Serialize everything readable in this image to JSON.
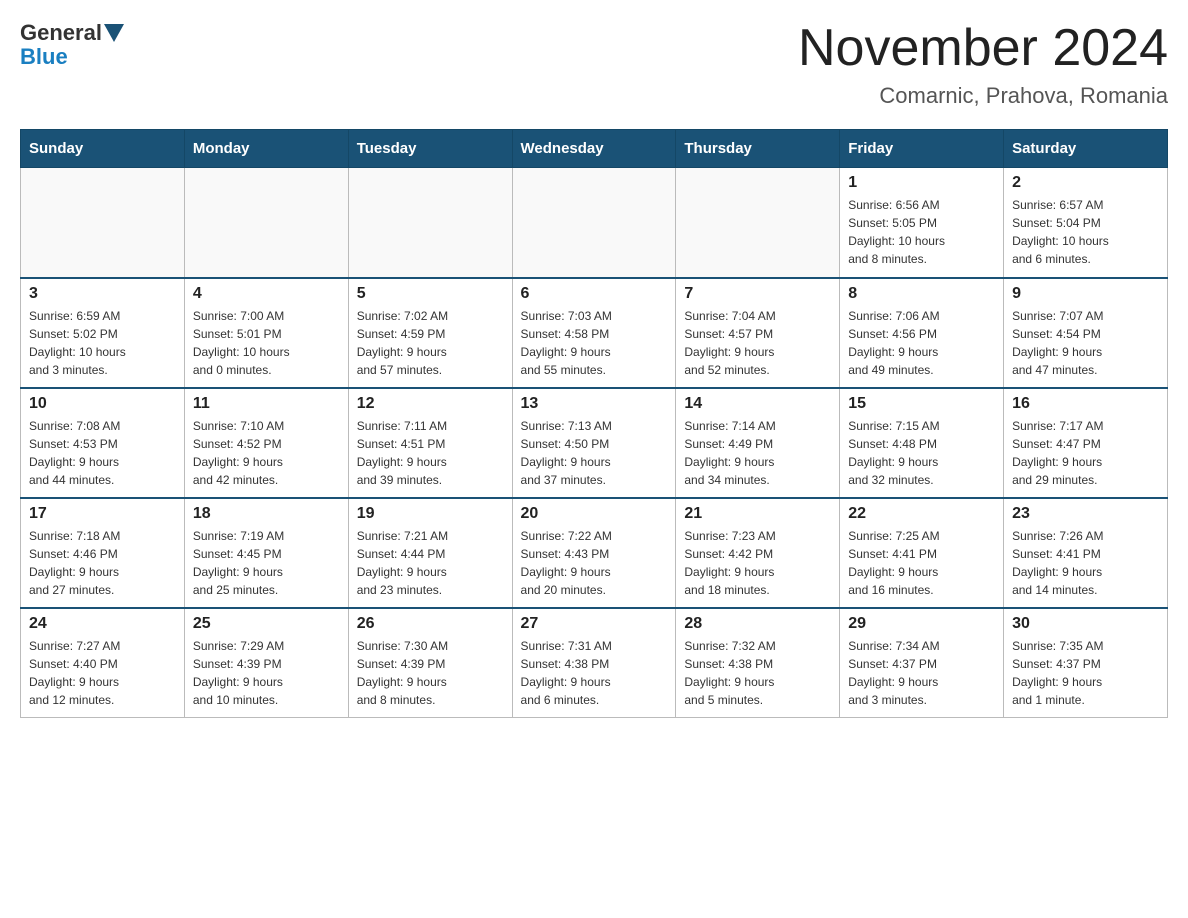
{
  "logo": {
    "general": "General",
    "blue": "Blue"
  },
  "header": {
    "title": "November 2024",
    "subtitle": "Comarnic, Prahova, Romania"
  },
  "weekdays": [
    "Sunday",
    "Monday",
    "Tuesday",
    "Wednesday",
    "Thursday",
    "Friday",
    "Saturday"
  ],
  "weeks": [
    [
      {
        "day": "",
        "info": ""
      },
      {
        "day": "",
        "info": ""
      },
      {
        "day": "",
        "info": ""
      },
      {
        "day": "",
        "info": ""
      },
      {
        "day": "",
        "info": ""
      },
      {
        "day": "1",
        "info": "Sunrise: 6:56 AM\nSunset: 5:05 PM\nDaylight: 10 hours\nand 8 minutes."
      },
      {
        "day": "2",
        "info": "Sunrise: 6:57 AM\nSunset: 5:04 PM\nDaylight: 10 hours\nand 6 minutes."
      }
    ],
    [
      {
        "day": "3",
        "info": "Sunrise: 6:59 AM\nSunset: 5:02 PM\nDaylight: 10 hours\nand 3 minutes."
      },
      {
        "day": "4",
        "info": "Sunrise: 7:00 AM\nSunset: 5:01 PM\nDaylight: 10 hours\nand 0 minutes."
      },
      {
        "day": "5",
        "info": "Sunrise: 7:02 AM\nSunset: 4:59 PM\nDaylight: 9 hours\nand 57 minutes."
      },
      {
        "day": "6",
        "info": "Sunrise: 7:03 AM\nSunset: 4:58 PM\nDaylight: 9 hours\nand 55 minutes."
      },
      {
        "day": "7",
        "info": "Sunrise: 7:04 AM\nSunset: 4:57 PM\nDaylight: 9 hours\nand 52 minutes."
      },
      {
        "day": "8",
        "info": "Sunrise: 7:06 AM\nSunset: 4:56 PM\nDaylight: 9 hours\nand 49 minutes."
      },
      {
        "day": "9",
        "info": "Sunrise: 7:07 AM\nSunset: 4:54 PM\nDaylight: 9 hours\nand 47 minutes."
      }
    ],
    [
      {
        "day": "10",
        "info": "Sunrise: 7:08 AM\nSunset: 4:53 PM\nDaylight: 9 hours\nand 44 minutes."
      },
      {
        "day": "11",
        "info": "Sunrise: 7:10 AM\nSunset: 4:52 PM\nDaylight: 9 hours\nand 42 minutes."
      },
      {
        "day": "12",
        "info": "Sunrise: 7:11 AM\nSunset: 4:51 PM\nDaylight: 9 hours\nand 39 minutes."
      },
      {
        "day": "13",
        "info": "Sunrise: 7:13 AM\nSunset: 4:50 PM\nDaylight: 9 hours\nand 37 minutes."
      },
      {
        "day": "14",
        "info": "Sunrise: 7:14 AM\nSunset: 4:49 PM\nDaylight: 9 hours\nand 34 minutes."
      },
      {
        "day": "15",
        "info": "Sunrise: 7:15 AM\nSunset: 4:48 PM\nDaylight: 9 hours\nand 32 minutes."
      },
      {
        "day": "16",
        "info": "Sunrise: 7:17 AM\nSunset: 4:47 PM\nDaylight: 9 hours\nand 29 minutes."
      }
    ],
    [
      {
        "day": "17",
        "info": "Sunrise: 7:18 AM\nSunset: 4:46 PM\nDaylight: 9 hours\nand 27 minutes."
      },
      {
        "day": "18",
        "info": "Sunrise: 7:19 AM\nSunset: 4:45 PM\nDaylight: 9 hours\nand 25 minutes."
      },
      {
        "day": "19",
        "info": "Sunrise: 7:21 AM\nSunset: 4:44 PM\nDaylight: 9 hours\nand 23 minutes."
      },
      {
        "day": "20",
        "info": "Sunrise: 7:22 AM\nSunset: 4:43 PM\nDaylight: 9 hours\nand 20 minutes."
      },
      {
        "day": "21",
        "info": "Sunrise: 7:23 AM\nSunset: 4:42 PM\nDaylight: 9 hours\nand 18 minutes."
      },
      {
        "day": "22",
        "info": "Sunrise: 7:25 AM\nSunset: 4:41 PM\nDaylight: 9 hours\nand 16 minutes."
      },
      {
        "day": "23",
        "info": "Sunrise: 7:26 AM\nSunset: 4:41 PM\nDaylight: 9 hours\nand 14 minutes."
      }
    ],
    [
      {
        "day": "24",
        "info": "Sunrise: 7:27 AM\nSunset: 4:40 PM\nDaylight: 9 hours\nand 12 minutes."
      },
      {
        "day": "25",
        "info": "Sunrise: 7:29 AM\nSunset: 4:39 PM\nDaylight: 9 hours\nand 10 minutes."
      },
      {
        "day": "26",
        "info": "Sunrise: 7:30 AM\nSunset: 4:39 PM\nDaylight: 9 hours\nand 8 minutes."
      },
      {
        "day": "27",
        "info": "Sunrise: 7:31 AM\nSunset: 4:38 PM\nDaylight: 9 hours\nand 6 minutes."
      },
      {
        "day": "28",
        "info": "Sunrise: 7:32 AM\nSunset: 4:38 PM\nDaylight: 9 hours\nand 5 minutes."
      },
      {
        "day": "29",
        "info": "Sunrise: 7:34 AM\nSunset: 4:37 PM\nDaylight: 9 hours\nand 3 minutes."
      },
      {
        "day": "30",
        "info": "Sunrise: 7:35 AM\nSunset: 4:37 PM\nDaylight: 9 hours\nand 1 minute."
      }
    ]
  ]
}
